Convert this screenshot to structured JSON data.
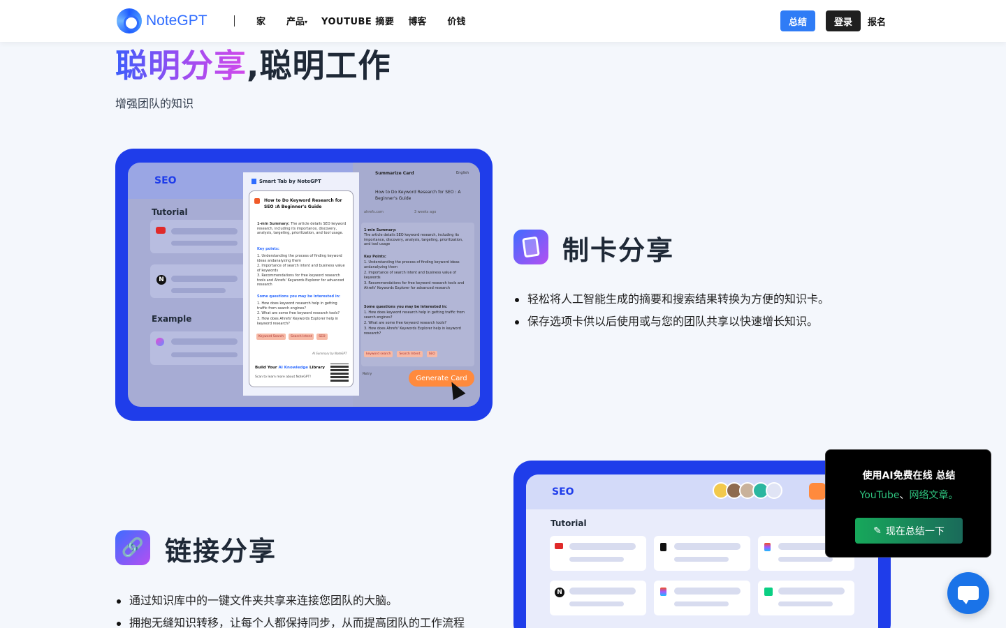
{
  "header": {
    "brand": "NoteGPT",
    "nav": [
      {
        "label": "家"
      },
      {
        "label": "产品"
      },
      {
        "label": "YOUTUBE 摘要"
      },
      {
        "label": "博客"
      },
      {
        "label": "价钱"
      }
    ],
    "summary_btn": "总结",
    "login_btn": "登录",
    "signup_link": "报名"
  },
  "hero": {
    "title_highlight": "聪明分享",
    "title_rest": ",聪明工作",
    "subtitle": "增强团队的知识"
  },
  "feature_card": {
    "title": "制卡分享",
    "bullets": [
      "轻松将人工智能生成的摘要和搜索结果转换为方便的知识卡。",
      "保存选项卡供以后使用或与您的团队共享以快速增长知识。"
    ],
    "image": {
      "seo": "SEO",
      "tutorial": "Tutorial",
      "example": "Example",
      "smart_tab": "Smart Tab by NoteGPT",
      "doc_title": "How to Do Keyword Research for SEO :A Beginner's Guide",
      "summary_label": "1-min Summary:",
      "summary_text": "The article details SEO keyword research, including its importance, discovery, analysis, targeting, prioritization, and tool usage.",
      "key_points_label": "Key points:",
      "key_points": [
        "1. Understanding the process of finding keyword ideas andanalyzing them",
        "2. Importance of search intent and business value of keywords",
        "3. Recommendations for free keyword research tools and Ahrefs' Keywords Explorer for advanced research"
      ],
      "questions_label": "Some questions you may be interested in:",
      "questions": [
        "1. How does keyword research help in getting traffic from search engines?",
        "2. What are some free keyword research tools?",
        "3. How does Ahrefs' Keywords Explorer help in keyword research?"
      ],
      "tags": [
        "Keyword Search",
        "Search Intent",
        "SEO"
      ],
      "ai_note": "AI Summary by NoteGPT",
      "build_prefix": "Build Your",
      "build_highlight": "AI Knowledge",
      "build_suffix": "Library",
      "scan_text": "Scan to learn more about NoteGPT!",
      "summarize_card": "Summarize Card",
      "language": "English",
      "rp_title": "How to Do Keyword Research for SEO : A Beginner's Guide",
      "rp_source": "ahrefs.com",
      "rp_time": "3 weeks ago",
      "rp_summary_label": "1-min Summary:",
      "rp_summary": "The article details SEO keyword research, including its importance, discovery, analysis, targeting, prioritization, and tool usage",
      "rp_key_points_label": "Key Points:",
      "rp_tags": [
        "keyword search",
        "Search Intent",
        "SEO"
      ],
      "retry": "Retry",
      "generate_btn": "Generate Card"
    }
  },
  "feature_link": {
    "title": "链接分享",
    "bullets": [
      "通过知识库中的一键文件夹共享来连接您团队的大脑。",
      "拥抱无缝知识转移，让每个人都保持同步，从而提高团队的工作流程"
    ],
    "image": {
      "seo": "SEO",
      "tutorial": "Tutorial"
    }
  },
  "promo": {
    "line1": "使用AI免费在线 总结",
    "youtube": "YouTube",
    "sep": "、",
    "web": "网络文章。",
    "btn": "现在总结一下"
  },
  "colors": {
    "primary": "#2f7cf6",
    "frame_blue": "#1f3dea",
    "promo_green": "#17a85b"
  }
}
